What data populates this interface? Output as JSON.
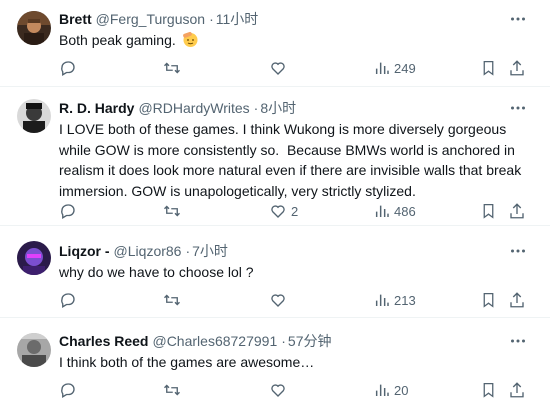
{
  "replies": [
    {
      "name": "Brett",
      "handle": "@Ferg_Turguson",
      "time": "11小时",
      "text": "Both peak gaming.",
      "emoji_icon": "saluting-face-emoji",
      "stats": {
        "views": "249"
      }
    },
    {
      "name": "R. D. Hardy",
      "handle": "@RDHardyWrites",
      "time": "8小时",
      "text_lines": [
        "I LOVE both of these games. I think Wukong is more diversely gorgeous",
        "while GOW is more consistently so.  Because BMWs world is anchored in",
        "realism it does look more natural even if there are invisible walls that break",
        "immersion. GOW is unapologetically, very strictly stylized."
      ],
      "stats": {
        "likes": "2",
        "views": "486"
      }
    },
    {
      "name": "Liqzor -",
      "handle": "@Liqzor86",
      "time": "7小时",
      "text": "why do we have to choose lol ?",
      "stats": {
        "views": "213"
      }
    },
    {
      "name": "Charles Reed",
      "handle": "@Charles68727991",
      "time": "57分钟",
      "text": "I think both of the games are awesome…",
      "stats": {
        "views": "20"
      }
    }
  ],
  "separator": "·",
  "colors": {
    "text": "#0f1419",
    "secondary": "#536471",
    "divider": "#eff3f4"
  }
}
